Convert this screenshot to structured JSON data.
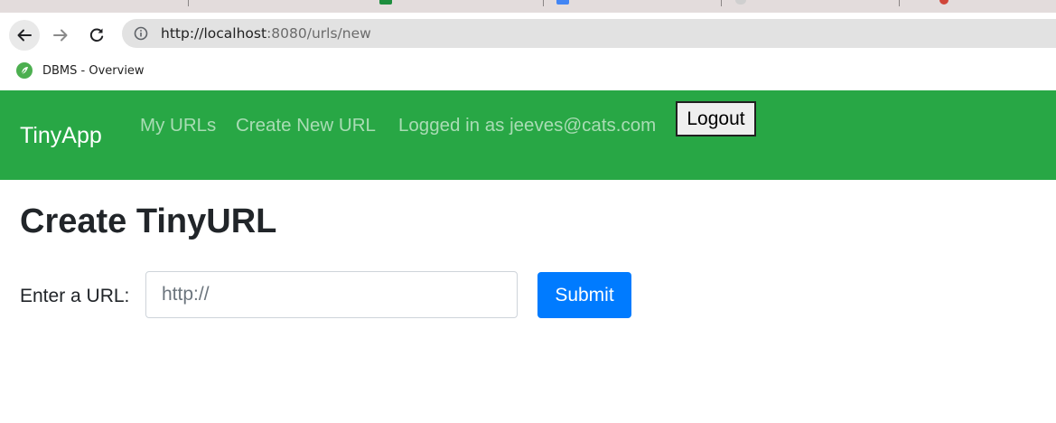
{
  "browser": {
    "address": {
      "host": "http://localhost",
      "path": ":8080/urls/new"
    },
    "bookmark": {
      "label": "DBMS - Overview"
    },
    "icons": {
      "back": "back-arrow-icon",
      "forward": "forward-arrow-icon",
      "reload": "reload-icon",
      "info": "info-icon",
      "bookmark": "bookmark-favicon"
    }
  },
  "navbar": {
    "brand": "TinyApp",
    "links": [
      {
        "label": "My URLs"
      },
      {
        "label": "Create New URL"
      }
    ],
    "login_status": "Logged in as jeeves@cats.com",
    "logout_label": "Logout",
    "color": "#28a745"
  },
  "main": {
    "title": "Create TinyURL",
    "form": {
      "label": "Enter a URL:",
      "placeholder": "http://",
      "value": "",
      "submit_label": "Submit",
      "submit_color": "#007bff"
    }
  }
}
